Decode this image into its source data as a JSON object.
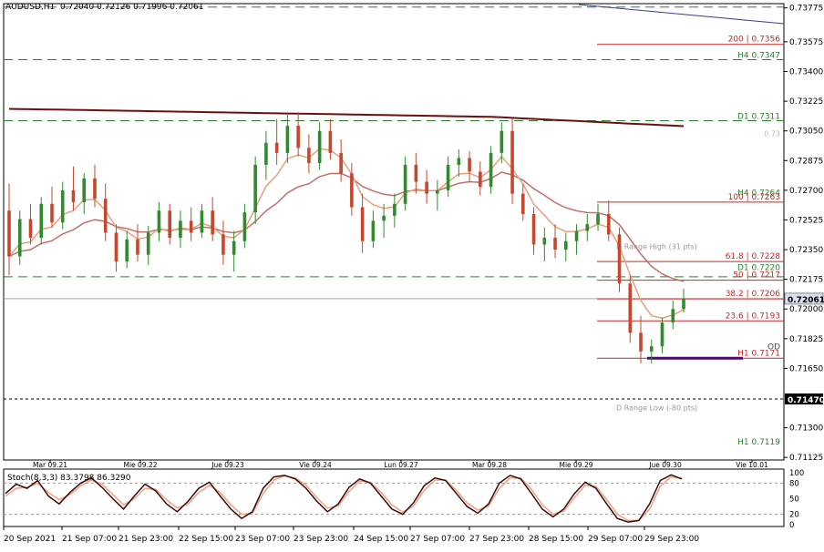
{
  "window": {
    "symbol": "AUDUSD,H1",
    "ohlc": "0.72040 0.72126 0.71996 0.72061"
  },
  "colors": {
    "bg": "#ffffff",
    "bull": "#2e8b2e",
    "bear": "#c8462c",
    "ma_slow": "#6b1010",
    "ma_mid": "#c0706a",
    "ma_fast": "#e8a07a",
    "level_green": "#2e7d32",
    "level_red": "#c62828",
    "stoch_main": "#3a0a0a",
    "stoch_signal": "#f0a080"
  },
  "chart_data": {
    "type": "candlestick",
    "ylim": [
      0.7111,
      0.738
    ],
    "price_ticks": [
      "0.73775",
      "0.73575",
      "0.73400",
      "0.73225",
      "0.73050",
      "0.72875",
      "0.72700",
      "0.72525",
      "0.72350",
      "0.72175",
      "0.72000",
      "0.71825",
      "0.71650",
      "0.71300",
      "0.71125"
    ],
    "current_price": "0.72061",
    "dotted_level": "0.71470",
    "date_labels_top": [
      "Mar 09.21",
      "Mie 09.22",
      "Jue 09.23",
      "Vie 09.24",
      "Lun 09.27",
      "Mar 09.28",
      "Mie 09.29",
      "Jue 09.30",
      "Vie 10.01"
    ],
    "date_labels_bottom": [
      "20 Sep 2021",
      "21 Sep 07:00",
      "21 Sep 23:00",
      "22 Sep 15:00",
      "23 Sep 07:00",
      "23 Sep 23:00",
      "24 Sep 15:00",
      "27 Sep 07:00",
      "27 Sep 23:00",
      "28 Sep 15:00",
      "29 Sep 07:00",
      "29 Sep 23:00"
    ],
    "levels": [
      {
        "label": "200  | 0.7356",
        "value": 0.7356,
        "kind": "fib"
      },
      {
        "label": "H4 0.7347",
        "value": 0.7347,
        "kind": "green_label"
      },
      {
        "label": "D1 0.7311",
        "value": 0.7311,
        "kind": "green_label"
      },
      {
        "label": "0.73",
        "value": 0.7302,
        "kind": "faint"
      },
      {
        "label": "H4 0.7264",
        "value": 0.7266,
        "kind": "green_label"
      },
      {
        "label": "100  | 0.7263",
        "value": 0.7263,
        "kind": "fib"
      },
      {
        "label": "D Range High (31 pts)",
        "value": 0.7237,
        "kind": "range"
      },
      {
        "label": "61.8  | 0.7228",
        "value": 0.7228,
        "kind": "fib"
      },
      {
        "label": "D1 0.7220",
        "value": 0.7222,
        "kind": "green_label"
      },
      {
        "label": "50  | 0.7217",
        "value": 0.7217,
        "kind": "fib"
      },
      {
        "label": "38.2  | 0.7206",
        "value": 0.7206,
        "kind": "fib"
      },
      {
        "label": "23.6  | 0.7193",
        "value": 0.7193,
        "kind": "fib"
      },
      {
        "label": "OD",
        "value": 0.718,
        "kind": "od"
      },
      {
        "label": "H1 0.7171",
        "value": 0.7171,
        "kind": "fib_h1"
      },
      {
        "label": "D Range Low (-80 pts)",
        "value": 0.7142,
        "kind": "range"
      },
      {
        "label": "H1 0.7119",
        "value": 0.7119,
        "kind": "green_label"
      }
    ],
    "green_dashed_levels": [
      0.7378,
      0.7347,
      0.7311,
      0.7219
    ],
    "candles": [
      [
        0.7258,
        0.7274,
        0.722,
        0.7231
      ],
      [
        0.7231,
        0.7258,
        0.7226,
        0.7253
      ],
      [
        0.7253,
        0.7262,
        0.7238,
        0.7242
      ],
      [
        0.7242,
        0.7266,
        0.7238,
        0.7262
      ],
      [
        0.7262,
        0.7272,
        0.7248,
        0.7251
      ],
      [
        0.7251,
        0.7275,
        0.7247,
        0.727
      ],
      [
        0.727,
        0.7284,
        0.7258,
        0.7263
      ],
      [
        0.7263,
        0.728,
        0.7256,
        0.7277
      ],
      [
        0.7277,
        0.7285,
        0.726,
        0.7265
      ],
      [
        0.7265,
        0.7274,
        0.724,
        0.7245
      ],
      [
        0.7245,
        0.725,
        0.7222,
        0.7228
      ],
      [
        0.7228,
        0.7246,
        0.7224,
        0.7241
      ],
      [
        0.7241,
        0.725,
        0.7228,
        0.7232
      ],
      [
        0.7232,
        0.7249,
        0.7226,
        0.7245
      ],
      [
        0.7245,
        0.7263,
        0.724,
        0.7258
      ],
      [
        0.7258,
        0.7262,
        0.7238,
        0.7242
      ],
      [
        0.7242,
        0.7258,
        0.7236,
        0.7252
      ],
      [
        0.7252,
        0.726,
        0.724,
        0.7245
      ],
      [
        0.7245,
        0.7262,
        0.7242,
        0.7258
      ],
      [
        0.7258,
        0.7266,
        0.724,
        0.7244
      ],
      [
        0.7244,
        0.7252,
        0.7226,
        0.7232
      ],
      [
        0.7232,
        0.7246,
        0.7222,
        0.724
      ],
      [
        0.724,
        0.7262,
        0.7236,
        0.7257
      ],
      [
        0.7257,
        0.729,
        0.725,
        0.7285
      ],
      [
        0.7285,
        0.7305,
        0.7276,
        0.7298
      ],
      [
        0.7298,
        0.7312,
        0.7285,
        0.7292
      ],
      [
        0.7292,
        0.7316,
        0.7286,
        0.7308
      ],
      [
        0.7308,
        0.7316,
        0.729,
        0.7295
      ],
      [
        0.7295,
        0.7303,
        0.728,
        0.7286
      ],
      [
        0.7286,
        0.731,
        0.7282,
        0.7305
      ],
      [
        0.7305,
        0.7312,
        0.7288,
        0.7292
      ],
      [
        0.7292,
        0.73,
        0.7275,
        0.728
      ],
      [
        0.728,
        0.7286,
        0.7255,
        0.726
      ],
      [
        0.726,
        0.7268,
        0.7233,
        0.724
      ],
      [
        0.724,
        0.7258,
        0.7236,
        0.7252
      ],
      [
        0.7252,
        0.7262,
        0.7242,
        0.7255
      ],
      [
        0.7255,
        0.7268,
        0.7248,
        0.7262
      ],
      [
        0.7262,
        0.729,
        0.7258,
        0.7285
      ],
      [
        0.7285,
        0.7292,
        0.7268,
        0.7275
      ],
      [
        0.7275,
        0.7282,
        0.7262,
        0.7268
      ],
      [
        0.7268,
        0.7276,
        0.7258,
        0.727
      ],
      [
        0.727,
        0.729,
        0.7266,
        0.7285
      ],
      [
        0.7285,
        0.7294,
        0.7278,
        0.7289
      ],
      [
        0.7289,
        0.7293,
        0.7275,
        0.7281
      ],
      [
        0.7281,
        0.7287,
        0.7267,
        0.7272
      ],
      [
        0.7272,
        0.7296,
        0.7268,
        0.7292
      ],
      [
        0.7292,
        0.731,
        0.7286,
        0.7305
      ],
      [
        0.7305,
        0.7312,
        0.7262,
        0.7268
      ],
      [
        0.7268,
        0.7274,
        0.7252,
        0.7256
      ],
      [
        0.7256,
        0.726,
        0.7232,
        0.7238
      ],
      [
        0.7238,
        0.7248,
        0.7228,
        0.7242
      ],
      [
        0.7242,
        0.725,
        0.723,
        0.7235
      ],
      [
        0.7235,
        0.7245,
        0.7228,
        0.724
      ],
      [
        0.724,
        0.725,
        0.7232,
        0.7246
      ],
      [
        0.7246,
        0.7256,
        0.724,
        0.725
      ],
      [
        0.725,
        0.7262,
        0.7246,
        0.7256
      ],
      [
        0.7256,
        0.7264,
        0.724,
        0.7244
      ],
      [
        0.7244,
        0.7248,
        0.721,
        0.7215
      ],
      [
        0.7215,
        0.722,
        0.718,
        0.7186
      ],
      [
        0.7186,
        0.7196,
        0.7168,
        0.7175
      ],
      [
        0.7175,
        0.7182,
        0.7168,
        0.7178
      ],
      [
        0.7178,
        0.7195,
        0.7174,
        0.7192
      ],
      [
        0.7192,
        0.7205,
        0.7188,
        0.72
      ],
      [
        0.72,
        0.7212,
        0.7198,
        0.7206
      ]
    ],
    "stoch": {
      "label": "Stoch(8,3,3) 83.3798 86.3290",
      "ticks": [
        "100",
        "80",
        "50",
        "20",
        "0"
      ],
      "main": [
        60,
        78,
        70,
        85,
        55,
        40,
        62,
        80,
        90,
        72,
        50,
        30,
        55,
        78,
        65,
        40,
        25,
        45,
        70,
        82,
        55,
        30,
        12,
        25,
        70,
        92,
        95,
        88,
        70,
        45,
        25,
        40,
        72,
        88,
        80,
        55,
        30,
        20,
        42,
        75,
        90,
        85,
        60,
        35,
        22,
        40,
        80,
        95,
        88,
        60,
        30,
        15,
        30,
        60,
        82,
        70,
        40,
        12,
        5,
        8,
        40,
        85,
        96,
        88
      ],
      "signal": [
        55,
        70,
        72,
        80,
        62,
        48,
        58,
        75,
        86,
        78,
        58,
        38,
        50,
        70,
        68,
        48,
        32,
        40,
        62,
        76,
        62,
        38,
        20,
        22,
        60,
        86,
        94,
        90,
        76,
        52,
        32,
        36,
        64,
        84,
        82,
        62,
        38,
        24,
        36,
        66,
        86,
        86,
        66,
        42,
        28,
        36,
        70,
        90,
        90,
        68,
        38,
        20,
        26,
        52,
        76,
        74,
        48,
        20,
        8,
        8,
        30,
        74,
        92,
        90
      ]
    }
  }
}
